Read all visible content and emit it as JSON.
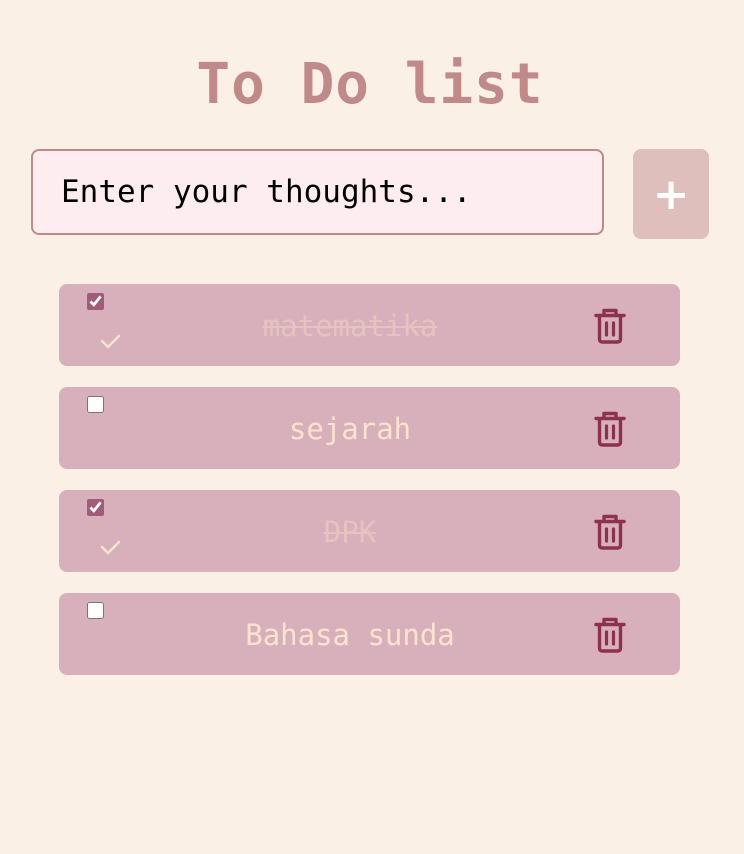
{
  "app": {
    "title": "To Do list"
  },
  "input": {
    "placeholder": "Enter your thoughts...",
    "value": ""
  },
  "add_button": {
    "label": "+"
  },
  "tasks": [
    {
      "text": "matematika",
      "checked": true
    },
    {
      "text": "sejarah",
      "checked": false
    },
    {
      "text": "DPK",
      "checked": true
    },
    {
      "text": "Bahasa sunda",
      "checked": false
    }
  ],
  "icons": {
    "delete": "trash-icon",
    "done": "check-icon"
  },
  "colors": {
    "background": "#faf0e6",
    "title": "#c08a8a",
    "input_border": "#c08a8a",
    "input_bg": "#fdecf0",
    "add_button": "#debfbb",
    "task_bg": "#d8b0bb",
    "task_text": "#fbe3cd",
    "task_done_text": "#e6c3c0",
    "trash_icon": "#8c3150"
  }
}
